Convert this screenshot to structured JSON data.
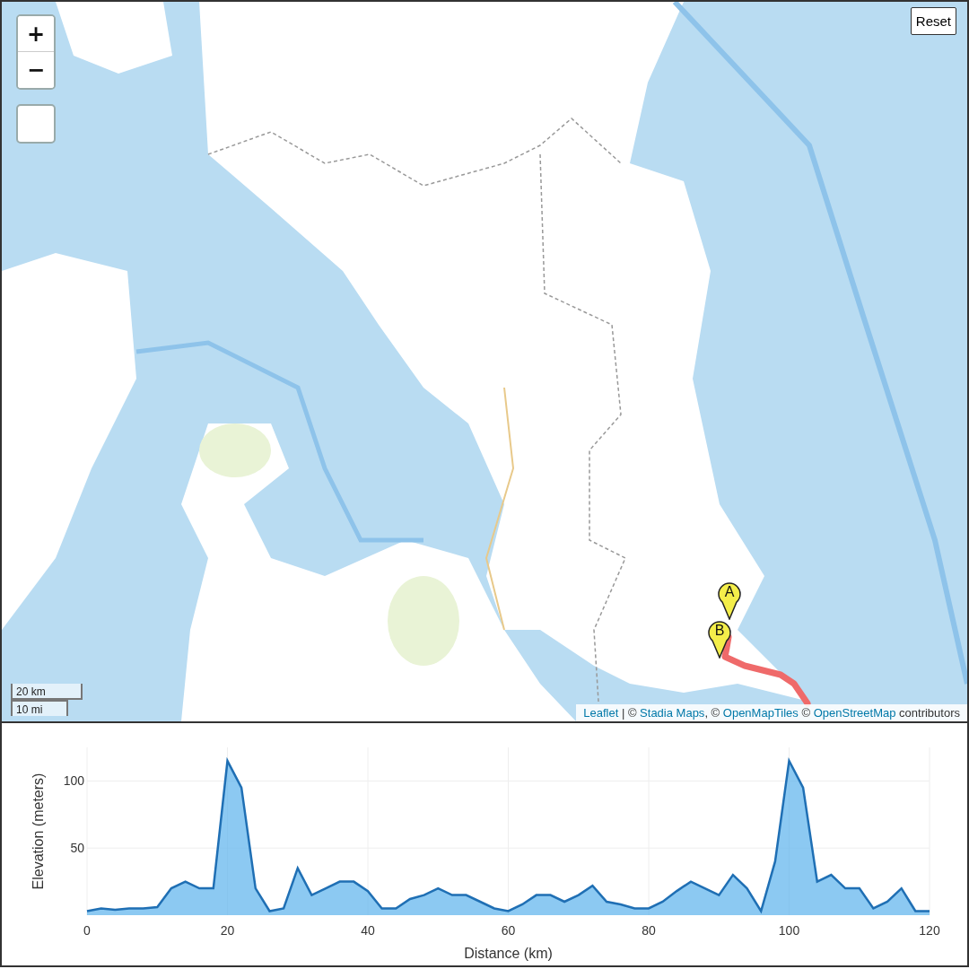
{
  "map": {
    "controls": [
      {
        "kind": "zoom_in",
        "label": "+"
      },
      {
        "kind": "zoom_out",
        "label": "−"
      },
      {
        "kind": "blank"
      }
    ],
    "reset_button": "Reset",
    "markers": [
      {
        "label": "A"
      },
      {
        "label": "B"
      }
    ],
    "scale": [
      "20 km",
      "10 mi"
    ],
    "attribution": [
      {
        "kind": "link",
        "text": "Leaflet"
      },
      {
        "kind": "text",
        "text": " | © "
      },
      {
        "kind": "link",
        "text": "Stadia Maps"
      },
      {
        "kind": "text",
        "text": ", © "
      },
      {
        "kind": "link",
        "text": "OpenMapTiles"
      },
      {
        "kind": "text",
        "text": " © "
      },
      {
        "kind": "link",
        "text": "OpenStreetMap"
      },
      {
        "kind": "text",
        "text": " contributors"
      }
    ]
  },
  "elevation": {
    "chart_data": {
      "type": "area",
      "xlabel": "Distance (km)",
      "ylabel": "Elevation (meters)",
      "x": [
        0,
        2,
        4,
        6,
        8,
        10,
        12,
        14,
        16,
        18,
        20,
        22,
        24,
        26,
        28,
        30,
        32,
        34,
        36,
        38,
        40,
        42,
        44,
        46,
        48,
        50,
        52,
        54,
        56,
        58,
        60,
        62,
        64,
        66,
        68,
        70,
        72,
        74,
        76,
        78,
        80,
        82,
        84,
        86,
        88,
        90,
        92,
        94,
        96,
        98,
        100,
        102,
        104,
        106,
        108,
        110,
        112,
        114,
        116,
        118,
        120
      ],
      "grid": true,
      "series": [
        {
          "color": "#1f6fb4",
          "values": [
            3,
            5,
            4,
            5,
            5,
            6,
            20,
            25,
            20,
            20,
            115,
            95,
            20,
            3,
            5,
            35,
            15,
            20,
            25,
            25,
            18,
            5,
            5,
            12,
            15,
            20,
            15,
            15,
            10,
            5,
            3,
            8,
            15,
            15,
            10,
            15,
            22,
            10,
            8,
            5,
            5,
            10,
            18,
            25,
            20,
            15,
            30,
            20,
            3,
            40,
            115,
            95,
            25,
            30,
            20,
            20,
            5,
            10,
            20,
            3,
            3
          ]
        }
      ],
      "xlim": [
        0,
        120
      ],
      "ylim": [
        0,
        125
      ],
      "xticks": [
        0,
        20,
        40,
        60,
        80,
        100,
        120
      ],
      "yticks": [
        50,
        100
      ]
    }
  }
}
